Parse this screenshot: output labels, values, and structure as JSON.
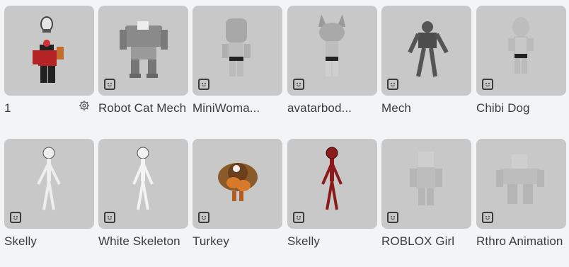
{
  "items": [
    {
      "name": "1",
      "badge": false,
      "settings_icon": "gear-icon"
    },
    {
      "name": "Robot Cat Mech",
      "badge": true
    },
    {
      "name": "MiniWoma...",
      "badge": true
    },
    {
      "name": "avatarbod...",
      "badge": true
    },
    {
      "name": "Mech",
      "badge": true
    },
    {
      "name": "Chibi Dog",
      "badge": true
    },
    {
      "name": "Skelly",
      "badge": true
    },
    {
      "name": "White Skeleton",
      "badge": true
    },
    {
      "name": "Turkey",
      "badge": true
    },
    {
      "name": "Skelly",
      "badge": true
    },
    {
      "name": "ROBLOX Girl",
      "badge": true
    },
    {
      "name": "Rthro Animation",
      "badge": true
    }
  ],
  "colors": {
    "page_bg": "#f2f4f5",
    "thumb_bg": "#c8c8c8",
    "text": "#393b3d"
  }
}
